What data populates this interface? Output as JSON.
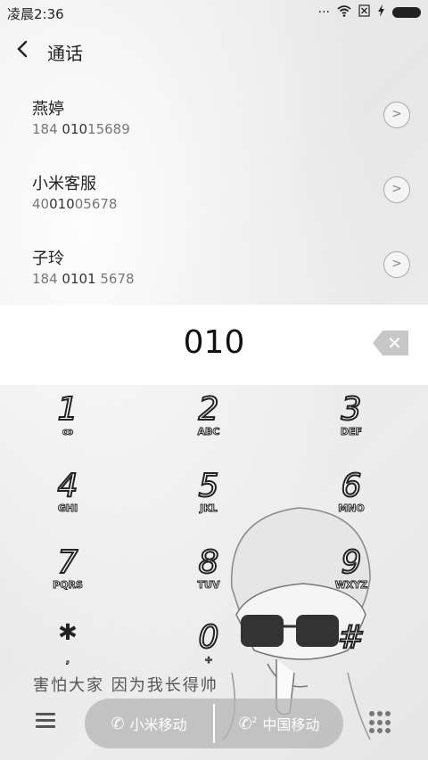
{
  "status": {
    "time": "凌晨2:36",
    "icons": [
      "more-dots-icon",
      "wifi-icon",
      "sim-off-icon",
      "charging-bolt-icon",
      "battery-icon"
    ]
  },
  "header": {
    "back_icon": "back-chevron-icon",
    "title": "通话"
  },
  "contacts": [
    {
      "name": "燕婷",
      "number_pre": "184 ",
      "number_match": "010",
      "number_post": "15689"
    },
    {
      "name": "小米客服",
      "number_pre": "40",
      "number_match": "010",
      "number_post": "05678"
    },
    {
      "name": "子玲",
      "number_pre": "184 ",
      "number_match": "0101",
      "number_post": " 5678"
    }
  ],
  "dialer": {
    "number": "010"
  },
  "keypad": [
    {
      "digit": "1",
      "letters": "ꝏ"
    },
    {
      "digit": "2",
      "letters": "ABC"
    },
    {
      "digit": "3",
      "letters": "DEF"
    },
    {
      "digit": "4",
      "letters": "GHI"
    },
    {
      "digit": "5",
      "letters": "JKL"
    },
    {
      "digit": "6",
      "letters": "MNO"
    },
    {
      "digit": "7",
      "letters": "PQRS"
    },
    {
      "digit": "8",
      "letters": "TUV"
    },
    {
      "digit": "9",
      "letters": "WXYZ"
    },
    {
      "digit": "*",
      "letters": ","
    },
    {
      "digit": "0",
      "letters": "+"
    },
    {
      "digit": "#",
      "letters": ""
    }
  ],
  "slogan": "害怕大家 因为我长得帅",
  "bottom": {
    "sim1_label": "小米移动",
    "sim2_label": "中国移动",
    "sim2_tag": "2"
  }
}
